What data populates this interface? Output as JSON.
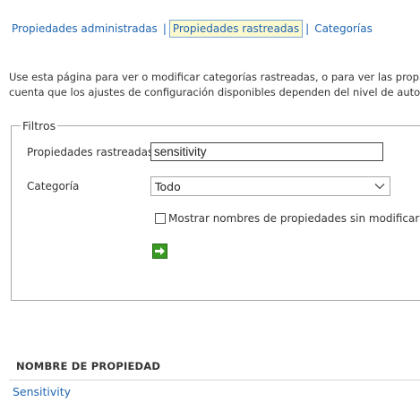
{
  "nav": {
    "items": [
      {
        "label": "Propiedades administradas"
      },
      {
        "label": "Propiedades rastreadas"
      },
      {
        "label": "Categorías"
      }
    ],
    "separator": "|"
  },
  "description": {
    "line1": "Use esta página para ver o modificar categorías rastreadas, o para ver las propied",
    "line2": "cuenta que los ajustes de configuración disponibles dependen del nivel de autori"
  },
  "filters": {
    "legend": "Filtros",
    "crawled_label": "Propiedades rastreadas",
    "crawled_value": "sensitivity",
    "category_label": "Categoría",
    "category_value": "Todo",
    "show_unmodified_label": "Mostrar nombres de propiedades sin modificar",
    "show_unmodified_checked": false
  },
  "results": {
    "column_header": "NOMBRE DE PROPIEDAD",
    "rows": [
      {
        "name": "Sensitivity"
      }
    ]
  },
  "icons": {
    "go": "arrow-right-icon",
    "dropdown": "chevron-down-icon"
  },
  "colors": {
    "link": "#1f65b0",
    "active_tab_bg": "#fdf9cf",
    "go_button": "#3a9a24"
  }
}
